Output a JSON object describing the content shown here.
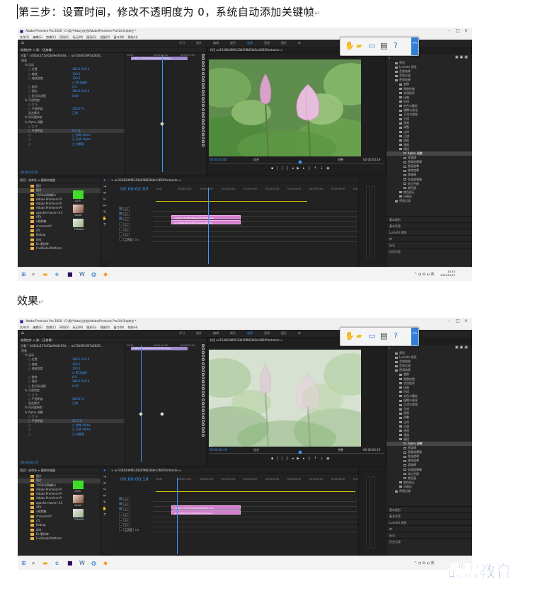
{
  "document": {
    "step_title": "第三步：设置时间，修改不透明度为 0，系统自动添加关键帧",
    "result_title": "效果",
    "watermark": "最需教育",
    "paragraph_mark": "↵"
  },
  "screenshots": [
    {
      "window_title": "Adobe Premiere Pro 2020 - C:\\用户\\hbsy\\文档\\Adobe\\Premiere Pro\\14.0\\未命名 *",
      "menu": [
        "文件(F)",
        "编辑(E)",
        "剪辑(C)",
        "序列(S)",
        "标记(M)",
        "图形(G)",
        "视图(V)",
        "窗口(W)",
        "帮助(H)"
      ],
      "workspaces": [
        "学习",
        "组件",
        "编辑",
        "颜色",
        "效果",
        "音频",
        "图形",
        "库"
      ],
      "active_workspace": "效果",
      "effect_controls": {
        "tabs": "效果控件 ≡   源：(无剪辑)",
        "clip_path": "主要 * 1d45bc175ef5bd9e0e03d...  ·  ue72d6f2d9f7a2826...",
        "rows": [
          {
            "label": "视频",
            "indent": 0
          },
          {
            "label": "fx  运动",
            "indent": 1
          },
          {
            "label": "○ 位置",
            "indent": 2,
            "value": "380.0     220.0"
          },
          {
            "label": "○ 缩放",
            "indent": 2,
            "value": "100.0"
          },
          {
            "label": "○ 缩放宽度",
            "indent": 2,
            "value": "100.0"
          },
          {
            "label": "",
            "indent": 2,
            "value": "☑ 等比缩放"
          },
          {
            "label": "○ 旋转",
            "indent": 2,
            "value": "0.0"
          },
          {
            "label": "○ 锚点",
            "indent": 2,
            "value": "380.0     220.0"
          },
          {
            "label": "○ 防闪烁滤镜",
            "indent": 2,
            "value": "0.00"
          },
          {
            "label": "fx  不透明度",
            "indent": 1
          },
          {
            "label": "○ □ ✎",
            "indent": 2
          },
          {
            "label": "○ 不透明度",
            "indent": 2,
            "value": "100.0 %"
          },
          {
            "label": "混合模式",
            "indent": 2,
            "value": "正常"
          },
          {
            "label": "fx  时间重映射",
            "indent": 1
          },
          {
            "label": "fx  Alpha 调整",
            "indent": 1
          },
          {
            "label": "○ □ ✎",
            "indent": 2
          },
          {
            "label": "○ 不透明度",
            "indent": 2,
            "value": "0.0 %",
            "highlight": true
          },
          {
            "label": "○",
            "indent": 2,
            "value": "□ 忽略 Alpha"
          },
          {
            "label": "○",
            "indent": 2,
            "value": "□ 反转 Alpha"
          },
          {
            "label": "○",
            "indent": 2,
            "value": "□ 仅蒙版"
          }
        ],
        "timecode": "00:00:02:00",
        "ruler": [
          "00:00",
          "00:00:01:00",
          "00:00:02:00"
        ]
      },
      "monitor": {
        "title": "节目  un15482d9f6C4342f9B03b9m26605mtracks  ≡",
        "left_time": "00:00:02:00",
        "fit": "适合",
        "quality": "完整",
        "right_time": "00:00:03:19"
      },
      "effects_panel": {
        "items": [
          {
            "label": "预设",
            "indent": 1,
            "type": "folder"
          },
          {
            "label": "Lumetri 预设",
            "indent": 1,
            "type": "folder"
          },
          {
            "label": "音频效果",
            "indent": 1,
            "type": "folder"
          },
          {
            "label": "音频过渡",
            "indent": 1,
            "type": "folder"
          },
          {
            "label": "视频效果",
            "indent": 1,
            "type": "folder"
          },
          {
            "label": "变换",
            "indent": 2,
            "type": "folder"
          },
          {
            "label": "图像控制",
            "indent": 2,
            "type": "folder"
          },
          {
            "label": "实用程序",
            "indent": 2,
            "type": "folder"
          },
          {
            "label": "扭曲",
            "indent": 2,
            "type": "folder"
          },
          {
            "label": "时间",
            "indent": 2,
            "type": "folder"
          },
          {
            "label": "杂色与颗粒",
            "indent": 2,
            "type": "folder"
          },
          {
            "label": "模糊与锐化",
            "indent": 2,
            "type": "folder"
          },
          {
            "label": "沉浸式视频",
            "indent": 2,
            "type": "folder"
          },
          {
            "label": "生成",
            "indent": 2,
            "type": "folder"
          },
          {
            "label": "视频",
            "indent": 2,
            "type": "folder"
          },
          {
            "label": "调整",
            "indent": 2,
            "type": "folder"
          },
          {
            "label": "过时",
            "indent": 2,
            "type": "folder"
          },
          {
            "label": "过渡",
            "indent": 2,
            "type": "folder"
          },
          {
            "label": "透视",
            "indent": 2,
            "type": "folder"
          },
          {
            "label": "通道",
            "indent": 2,
            "type": "folder"
          },
          {
            "label": "键控",
            "indent": 2,
            "type": "folder"
          },
          {
            "label": "Alpha 调整",
            "indent": 3,
            "type": "fx",
            "selected": true
          },
          {
            "label": "亮度键",
            "indent": 3,
            "type": "fx"
          },
          {
            "label": "图像遮罩键",
            "indent": 3,
            "type": "fx"
          },
          {
            "label": "差值遮罩",
            "indent": 3,
            "type": "fx"
          },
          {
            "label": "移除遮罩",
            "indent": 3,
            "type": "fx"
          },
          {
            "label": "超级键",
            "indent": 3,
            "type": "fx"
          },
          {
            "label": "轨道遮罩键",
            "indent": 3,
            "type": "fx"
          },
          {
            "label": "非红色键",
            "indent": 3,
            "type": "fx"
          },
          {
            "label": "颜色键",
            "indent": 3,
            "type": "fx"
          },
          {
            "label": "颜色校正",
            "indent": 2,
            "type": "folder"
          },
          {
            "label": "风格化",
            "indent": 2,
            "type": "folder"
          },
          {
            "label": "视频过渡",
            "indent": 1,
            "type": "folder"
          }
        ],
        "sub_panels": [
          "基本图形",
          "基本声音",
          "Lumetri 颜色",
          "库",
          "标记",
          "历史记录"
        ]
      },
      "project": {
        "tabs": "项目：未命名  ≡   媒体浏览器",
        "rows": [
          {
            "label": "图片",
            "selected": false
          },
          {
            "label": "照片",
            "selected": true
          },
          {
            "label": "1502a1购物Ex",
            "selected": false
          },
          {
            "label": "Adobe Premiere Pr",
            "selected": false
          },
          {
            "label": "Adobe Premiere Pr",
            "selected": false
          },
          {
            "label": "Adobe Premiere Pr",
            "selected": false
          },
          {
            "label": "apache-maven-3.5",
            "selected": false
          },
          {
            "label": "ATA",
            "selected": false
          },
          {
            "label": "a视频集",
            "selected": false
          },
          {
            "label": "chromedirf",
            "selected": false
          },
          {
            "label": "cfz",
            "selected": false
          },
          {
            "label": "Debug",
            "selected": false
          },
          {
            "label": "dist",
            "selected": false
          },
          {
            "label": "Es.素材库",
            "selected": false
          },
          {
            "label": "FruitSalesPlatform",
            "selected": false
          }
        ],
        "thumbs": [
          "1D35",
          "1bee6",
          "f33e0a5"
        ]
      },
      "sequence": {
        "title": "× un15482d9f6C4342f9B03b9m26605mtracks  ≡",
        "timecode": "00:00:02:00",
        "ruler": [
          "00:00",
          "00:00:01:00",
          "00:00:02:00",
          "00:00:03:00",
          "00:00:04:00",
          "00:00:05:00",
          "00:00:06:00",
          "00:00:07:00",
          "00:00:08:00",
          "00:00:09:00"
        ],
        "tracks": [
          "V3",
          "V2",
          "V1",
          "A1",
          "A2",
          "A3",
          "主声道"
        ],
        "master_value": "0.0",
        "clip_v2": "1d45bc175ef5bd9e0e03e03948.jpeg",
        "clip_v1": "ue72d6f2d9f7a28267be0ebe9f.jpeg"
      },
      "taskbar": {
        "time": "10:18",
        "date": "2021/11/12"
      }
    },
    {
      "window_title": "Adobe Premiere Pro 2020 - C:\\用户\\hbsy\\文档\\Adobe\\Premiere Pro\\14.0\\未命名 *",
      "menu": [
        "文件(F)",
        "编辑(E)",
        "剪辑(C)",
        "序列(S)",
        "标记(M)",
        "图形(G)",
        "视图(V)",
        "窗口(W)",
        "帮助(H)"
      ],
      "workspaces": [
        "学习",
        "组件",
        "编辑",
        "颜色",
        "效果",
        "音频",
        "图形",
        "库"
      ],
      "active_workspace": "效果",
      "effect_controls": {
        "tabs": "效果控件 ≡   源：(无剪辑)",
        "clip_path": "主要 * 1d45bc175ef5bd9e0e03d...  ·  ue72d6f2d9f7a2826...",
        "rows": [
          {
            "label": "视频",
            "indent": 0
          },
          {
            "label": "fx  运动",
            "indent": 1
          },
          {
            "label": "○ 位置",
            "indent": 2,
            "value": "380.0     220.0"
          },
          {
            "label": "○ 缩放",
            "indent": 2,
            "value": "100.0"
          },
          {
            "label": "○ 缩放宽度",
            "indent": 2,
            "value": "100.0"
          },
          {
            "label": "",
            "indent": 2,
            "value": "☑ 等比缩放"
          },
          {
            "label": "○ 旋转",
            "indent": 2,
            "value": "0.0"
          },
          {
            "label": "○ 锚点",
            "indent": 2,
            "value": "380.0     220.0"
          },
          {
            "label": "○ 防闪烁滤镜",
            "indent": 2,
            "value": "0.00"
          },
          {
            "label": "fx  不透明度",
            "indent": 1
          },
          {
            "label": "○ □ ✎",
            "indent": 2
          },
          {
            "label": "○ 不透明度",
            "indent": 2,
            "value": "100.0 %"
          },
          {
            "label": "混合模式",
            "indent": 2,
            "value": "正常"
          },
          {
            "label": "fx  时间重映射",
            "indent": 1
          },
          {
            "label": "fx  Alpha 调整",
            "indent": 1
          },
          {
            "label": "○ □ ✎",
            "indent": 2
          },
          {
            "label": "○ 不透明度",
            "indent": 2,
            "value": "52.6 %",
            "highlight": true
          },
          {
            "label": "○",
            "indent": 2,
            "value": "□ 忽略 Alpha"
          },
          {
            "label": "○",
            "indent": 2,
            "value": "□ 反转 Alpha"
          },
          {
            "label": "○",
            "indent": 2,
            "value": "□ 仅蒙版"
          }
        ],
        "timecode": "00:00:00:19",
        "ruler": [
          "00:00",
          "00:00:01:00",
          "00:00:02:00"
        ]
      },
      "monitor": {
        "title": "节目  un15482d9f6C4342f9B03b9m26605mtracks  ≡",
        "left_time": "00:00:00:19",
        "fit": "适合",
        "quality": "完整",
        "right_time": "00:00:03:19"
      },
      "effects_panel": {
        "items": [
          {
            "label": "预设",
            "indent": 1,
            "type": "folder"
          },
          {
            "label": "Lumetri 预设",
            "indent": 1,
            "type": "folder"
          },
          {
            "label": "音频效果",
            "indent": 1,
            "type": "folder"
          },
          {
            "label": "音频过渡",
            "indent": 1,
            "type": "folder"
          },
          {
            "label": "视频效果",
            "indent": 1,
            "type": "folder"
          },
          {
            "label": "变换",
            "indent": 2,
            "type": "folder"
          },
          {
            "label": "图像控制",
            "indent": 2,
            "type": "folder"
          },
          {
            "label": "实用程序",
            "indent": 2,
            "type": "folder"
          },
          {
            "label": "扭曲",
            "indent": 2,
            "type": "folder"
          },
          {
            "label": "时间",
            "indent": 2,
            "type": "folder"
          },
          {
            "label": "杂色与颗粒",
            "indent": 2,
            "type": "folder"
          },
          {
            "label": "模糊与锐化",
            "indent": 2,
            "type": "folder"
          },
          {
            "label": "沉浸式视频",
            "indent": 2,
            "type": "folder"
          },
          {
            "label": "生成",
            "indent": 2,
            "type": "folder"
          },
          {
            "label": "视频",
            "indent": 2,
            "type": "folder"
          },
          {
            "label": "调整",
            "indent": 2,
            "type": "folder"
          },
          {
            "label": "过时",
            "indent": 2,
            "type": "folder"
          },
          {
            "label": "过渡",
            "indent": 2,
            "type": "folder"
          },
          {
            "label": "透视",
            "indent": 2,
            "type": "folder"
          },
          {
            "label": "通道",
            "indent": 2,
            "type": "folder"
          },
          {
            "label": "键控",
            "indent": 2,
            "type": "folder"
          },
          {
            "label": "Alpha 调整",
            "indent": 3,
            "type": "fx",
            "selected": true
          },
          {
            "label": "亮度键",
            "indent": 3,
            "type": "fx"
          },
          {
            "label": "图像遮罩键",
            "indent": 3,
            "type": "fx"
          },
          {
            "label": "差值遮罩",
            "indent": 3,
            "type": "fx"
          },
          {
            "label": "移除遮罩",
            "indent": 3,
            "type": "fx"
          },
          {
            "label": "超级键",
            "indent": 3,
            "type": "fx"
          },
          {
            "label": "轨道遮罩键",
            "indent": 3,
            "type": "fx"
          },
          {
            "label": "非红色键",
            "indent": 3,
            "type": "fx"
          },
          {
            "label": "颜色键",
            "indent": 3,
            "type": "fx"
          },
          {
            "label": "颜色校正",
            "indent": 2,
            "type": "folder"
          },
          {
            "label": "风格化",
            "indent": 2,
            "type": "folder"
          },
          {
            "label": "视频过渡",
            "indent": 1,
            "type": "folder"
          }
        ],
        "sub_panels": [
          "基本图形",
          "基本声音",
          "Lumetri 颜色",
          "库",
          "标记",
          "历史记录"
        ]
      },
      "project": {
        "tabs": "项目：未命名  ≡   媒体浏览器",
        "rows": [
          {
            "label": "图片",
            "selected": false
          },
          {
            "label": "照片",
            "selected": true
          },
          {
            "label": "1502a1购物Ex",
            "selected": false
          },
          {
            "label": "Adobe Premiere Pr",
            "selected": false
          },
          {
            "label": "Adobe Premiere Pr",
            "selected": false
          },
          {
            "label": "Adobe Premiere Pr",
            "selected": false
          },
          {
            "label": "apache-maven-3.5",
            "selected": false
          },
          {
            "label": "ATA",
            "selected": false
          },
          {
            "label": "a视频集",
            "selected": false
          },
          {
            "label": "chromedirf",
            "selected": false
          },
          {
            "label": "cfz",
            "selected": false
          },
          {
            "label": "Debug",
            "selected": false
          },
          {
            "label": "dist",
            "selected": false
          },
          {
            "label": "Es.素材库",
            "selected": false
          },
          {
            "label": "FruitSalesPlatform",
            "selected": false
          }
        ],
        "thumbs": [
          "1D35",
          "1bee6",
          "f33e0a5"
        ]
      },
      "sequence": {
        "title": "× un15482d9f6C4342f9B03b9m26605mtracks  ≡",
        "timecode": "00:00:00:19",
        "ruler": [
          "00:00",
          "00:00:01:00",
          "00:00:02:00",
          "00:00:03:00",
          "00:00:04:00",
          "00:00:05:00",
          "00:00:06:00",
          "00:00:07:00",
          "00:00:08:00",
          "00:00:09:00"
        ],
        "tracks": [
          "V3",
          "V2",
          "V1",
          "A1",
          "A2",
          "A3",
          "主声道"
        ],
        "master_value": "0.0",
        "clip_v2": "1d45bc175ef5bd9e0e03e03948.jpeg",
        "clip_v1": "ue72d6f2d9f7a28267be0ebe9f.jpeg"
      },
      "taskbar": {
        "time": "",
        "date": ""
      }
    }
  ]
}
